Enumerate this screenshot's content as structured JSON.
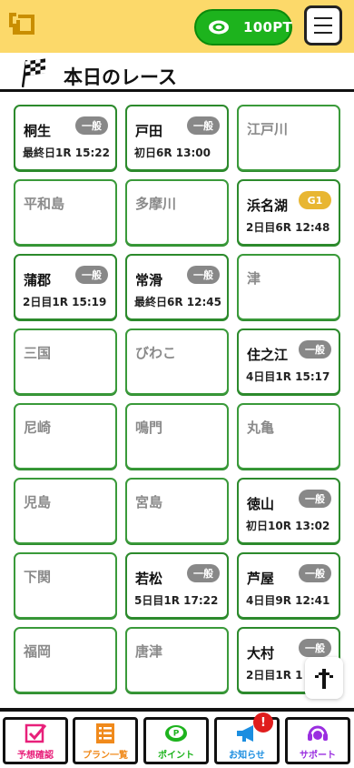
{
  "header": {
    "points_label": "100PT"
  },
  "page": {
    "title": "本日のレース"
  },
  "venues": [
    {
      "name": "桐生",
      "active": true,
      "badge": "一般",
      "badge_type": "normal",
      "time": "最終日1R 15:22"
    },
    {
      "name": "戸田",
      "active": true,
      "badge": "一般",
      "badge_type": "normal",
      "time": "初日6R 13:00"
    },
    {
      "name": "江戸川",
      "active": false
    },
    {
      "name": "平和島",
      "active": false
    },
    {
      "name": "多摩川",
      "active": false
    },
    {
      "name": "浜名湖",
      "active": true,
      "badge": "G1",
      "badge_type": "g1",
      "time": "2日目6R 12:48"
    },
    {
      "name": "蒲郡",
      "active": true,
      "badge": "一般",
      "badge_type": "normal",
      "time": "2日目1R 15:19"
    },
    {
      "name": "常滑",
      "active": true,
      "badge": "一般",
      "badge_type": "normal",
      "time": "最終日6R 12:45"
    },
    {
      "name": "津",
      "active": false
    },
    {
      "name": "三国",
      "active": false
    },
    {
      "name": "びわこ",
      "active": false
    },
    {
      "name": "住之江",
      "active": true,
      "badge": "一般",
      "badge_type": "normal",
      "time": "4日目1R 15:17"
    },
    {
      "name": "尼崎",
      "active": false
    },
    {
      "name": "鳴門",
      "active": false
    },
    {
      "name": "丸亀",
      "active": false
    },
    {
      "name": "児島",
      "active": false
    },
    {
      "name": "宮島",
      "active": false
    },
    {
      "name": "徳山",
      "active": true,
      "badge": "一般",
      "badge_type": "normal",
      "time": "初日10R 13:02"
    },
    {
      "name": "下関",
      "active": false
    },
    {
      "name": "若松",
      "active": true,
      "badge": "一般",
      "badge_type": "normal",
      "time": "5日目1R 17:22"
    },
    {
      "name": "芦屋",
      "active": true,
      "badge": "一般",
      "badge_type": "normal",
      "time": "4日目9R 12:41"
    },
    {
      "name": "福岡",
      "active": false
    },
    {
      "name": "唐津",
      "active": false
    },
    {
      "name": "大村",
      "active": true,
      "badge": "一般",
      "badge_type": "normal",
      "time": "2日目1R 1"
    }
  ],
  "nav": [
    {
      "label": "予想確認",
      "icon": "checkbox-icon",
      "color": "#e8207a"
    },
    {
      "label": "プラン一覧",
      "icon": "list-icon",
      "color": "#f08a1c"
    },
    {
      "label": "ポイント",
      "icon": "point-coin-icon",
      "color": "#1db31d"
    },
    {
      "label": "お知らせ",
      "icon": "megaphone-icon",
      "color": "#1c8ee0",
      "badge": "!"
    },
    {
      "label": "サポート",
      "icon": "headset-icon",
      "color": "#9a2ee0"
    }
  ],
  "colors": {
    "header_bg": "#fcd96a",
    "card_border": "#2c8a2c",
    "badge_normal": "#888888",
    "badge_g1": "#e8b632",
    "points_green": "#1db31d"
  }
}
